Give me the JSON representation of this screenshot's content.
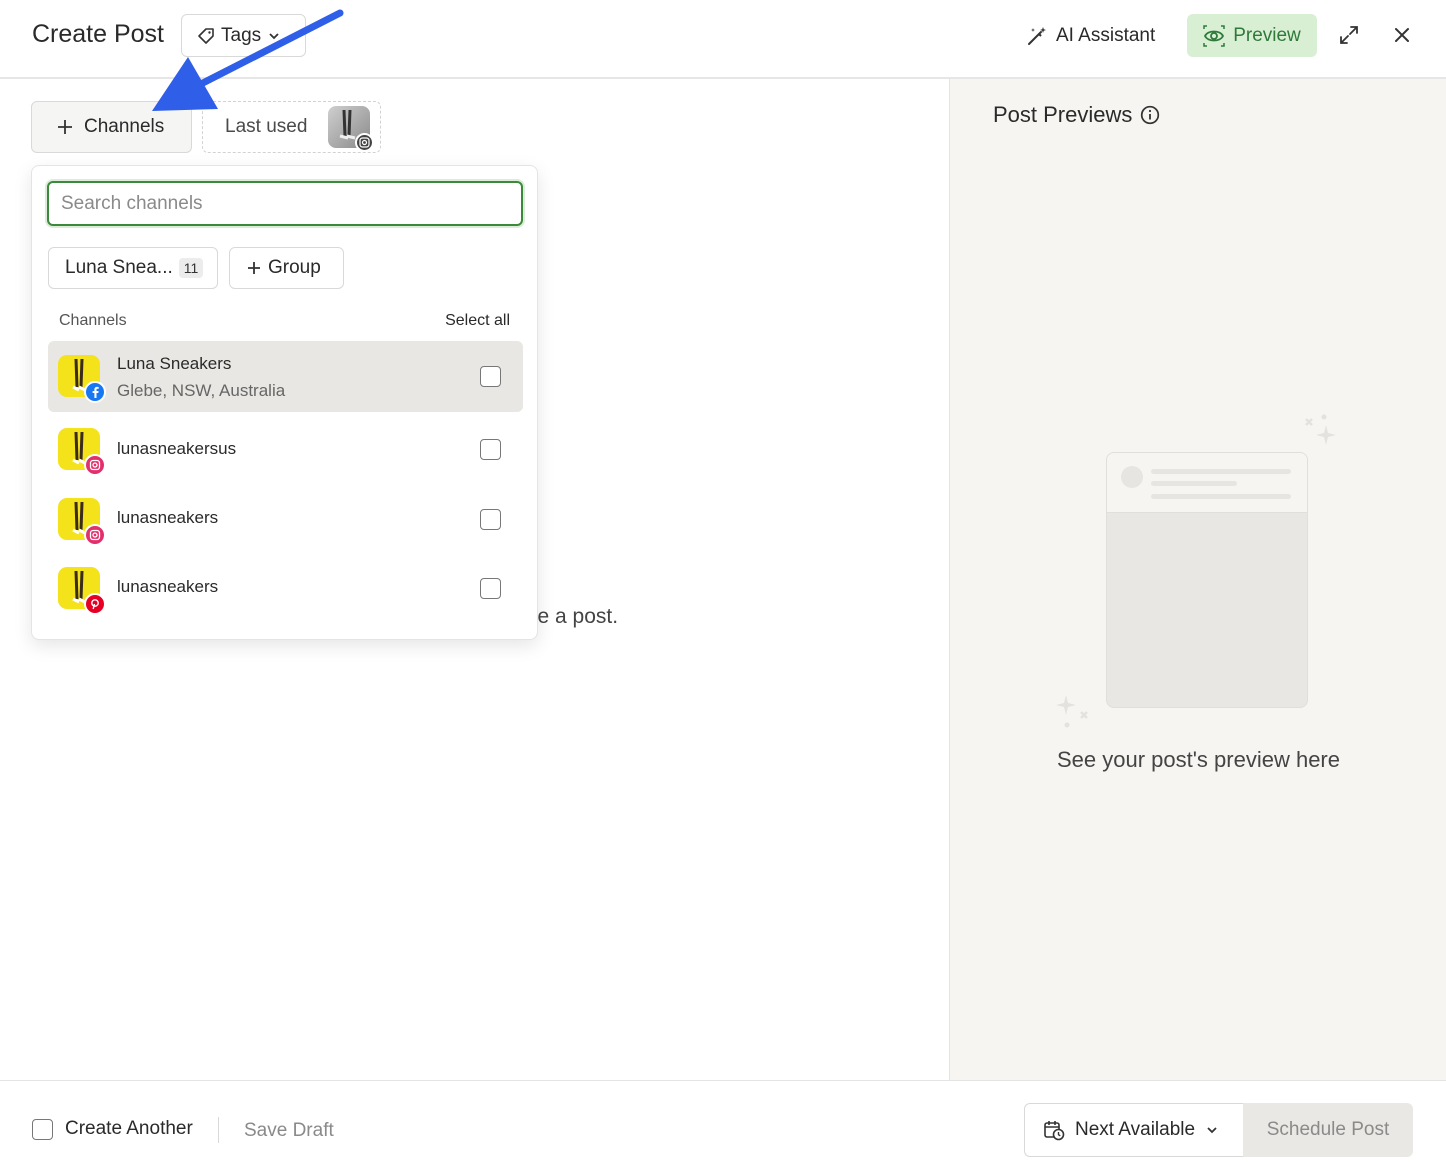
{
  "header": {
    "title": "Create Post",
    "tags_label": "Tags",
    "ai_label": "AI Assistant",
    "preview_label": "Preview"
  },
  "composer": {
    "channels_label": "Channels",
    "last_used_label": "Last used",
    "background_text": "ate a post."
  },
  "dropdown": {
    "search_placeholder": "Search channels",
    "group_chip_label": "Luna Snea...",
    "group_chip_count": "11",
    "add_group_label": "Group",
    "list_header": "Channels",
    "select_all_label": "Select all",
    "items": [
      {
        "name": "Luna Sneakers",
        "subtitle": "Glebe, NSW, Australia",
        "network": "facebook",
        "badge_color": "#1877f2",
        "checked": false
      },
      {
        "name": "lunasneakersus",
        "subtitle": "",
        "network": "instagram",
        "badge_color": "#e1306c",
        "checked": false
      },
      {
        "name": "lunasneakers",
        "subtitle": "",
        "network": "instagram",
        "badge_color": "#e1306c",
        "checked": false
      },
      {
        "name": "lunasneakers",
        "subtitle": "",
        "network": "pinterest",
        "badge_color": "#e60023",
        "checked": false
      }
    ]
  },
  "previews": {
    "title": "Post Previews",
    "empty_text": "See your post's preview here"
  },
  "footer": {
    "create_another_label": "Create Another",
    "save_draft_label": "Save Draft",
    "next_available_label": "Next Available",
    "schedule_label": "Schedule Post"
  },
  "colors": {
    "accent_green": "#2f7a3a",
    "preview_bg": "#d8efd3",
    "annotation_arrow": "#2f5fe8"
  }
}
